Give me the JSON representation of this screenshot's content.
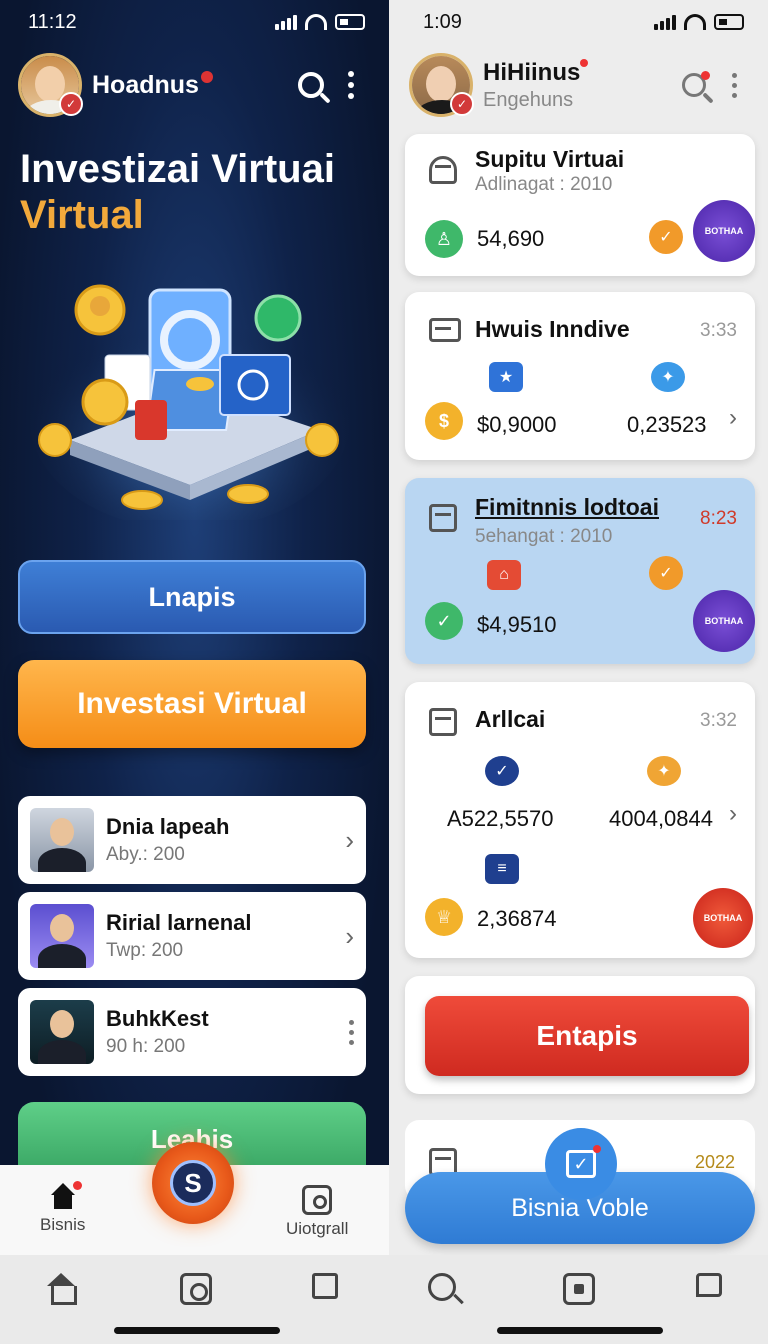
{
  "left": {
    "status": {
      "time": "11:12"
    },
    "header": {
      "username": "Hoadnus"
    },
    "hero": {
      "title": "Investizai Virtuai",
      "subtitle": "Virtual"
    },
    "buttons": {
      "primary": "Lnapis",
      "invest": "Investasi Virtual",
      "green": "Leahis"
    },
    "list": [
      {
        "name": "Dnia lapeah",
        "meta": "Aby.: 200"
      },
      {
        "name": "Ririal larnenal",
        "meta": "Twp: 200"
      },
      {
        "name": "BuhkKest",
        "meta": "90 h: 200"
      }
    ],
    "bottom_nav": {
      "home_label": "Bisnis",
      "right_label": "Uiotgrall",
      "fab_letter": "S"
    }
  },
  "right": {
    "status": {
      "time": "1:09"
    },
    "header": {
      "username": "HiHiinus",
      "subtitle": "Engehuns"
    },
    "cards": [
      {
        "title": "Supitu Virtuai",
        "subtitle": "Adlinagat : 2010",
        "value": "54,690",
        "badge": "BOTHAA"
      },
      {
        "title": "Hwuis Inndive",
        "time": "3:33",
        "value_a": "$0,9000",
        "value_b": "0,23523"
      },
      {
        "title": "Fimitnnis lodtoai",
        "subtitle": "5ehangat : 2010",
        "time": "8:23",
        "value": "$4,9510",
        "badge": "BOTHAA"
      },
      {
        "title": "Arllcai",
        "time": "3:32",
        "value_a": "A522,5570",
        "value_b": "4004,0844",
        "value_c": "2,36874",
        "badge": "BOTHAA"
      }
    ],
    "cta": "Entapis",
    "peek_year": "2022",
    "pill": "Bisnia Voble"
  },
  "colors": {
    "accent_orange": "#f58d17",
    "accent_blue": "#2f7bd4",
    "accent_red": "#cf2a20",
    "accent_green": "#2f9b5a"
  }
}
